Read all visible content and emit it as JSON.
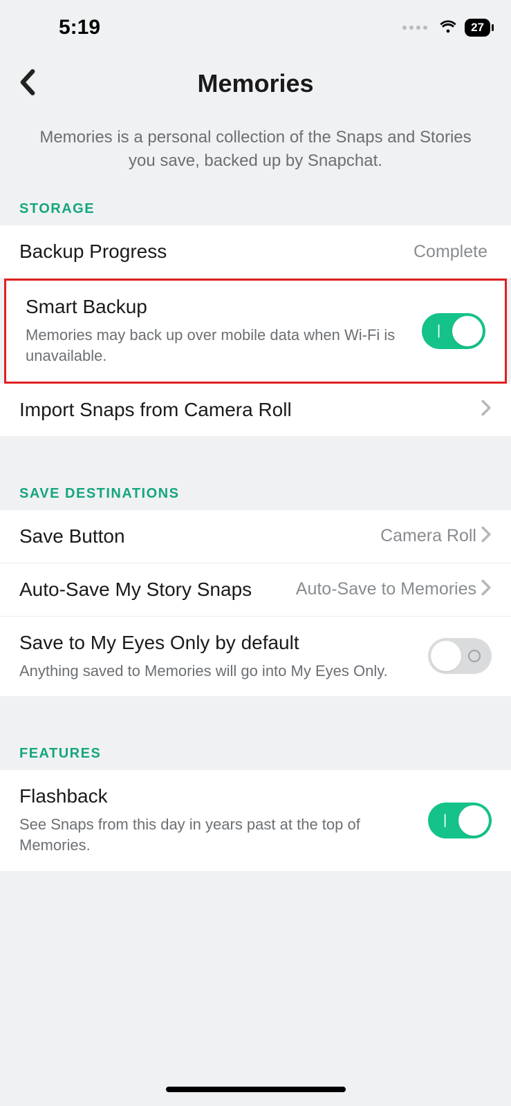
{
  "status_bar": {
    "time": "5:19",
    "battery": "27"
  },
  "header": {
    "title": "Memories"
  },
  "description": "Memories is a personal collection of the Snaps and Stories you save, backed up by Snapchat.",
  "sections": {
    "storage": {
      "header": "STORAGE",
      "backup_progress": {
        "label": "Backup Progress",
        "value": "Complete"
      },
      "smart_backup": {
        "label": "Smart Backup",
        "sub": "Memories may back up over mobile data when Wi-Fi is unavailable."
      },
      "import": {
        "label": "Import Snaps from Camera Roll"
      }
    },
    "save_destinations": {
      "header": "SAVE DESTINATIONS",
      "save_button": {
        "label": "Save Button",
        "value": "Camera Roll"
      },
      "auto_save": {
        "label": "Auto-Save My Story Snaps",
        "value": "Auto-Save to Memories"
      },
      "eyes_only": {
        "label": "Save to My Eyes Only by default",
        "sub": "Anything saved to Memories will go into My Eyes Only."
      }
    },
    "features": {
      "header": "FEATURES",
      "flashback": {
        "label": "Flashback",
        "sub": "See Snaps from this day in years past at the top of Memories."
      }
    }
  }
}
